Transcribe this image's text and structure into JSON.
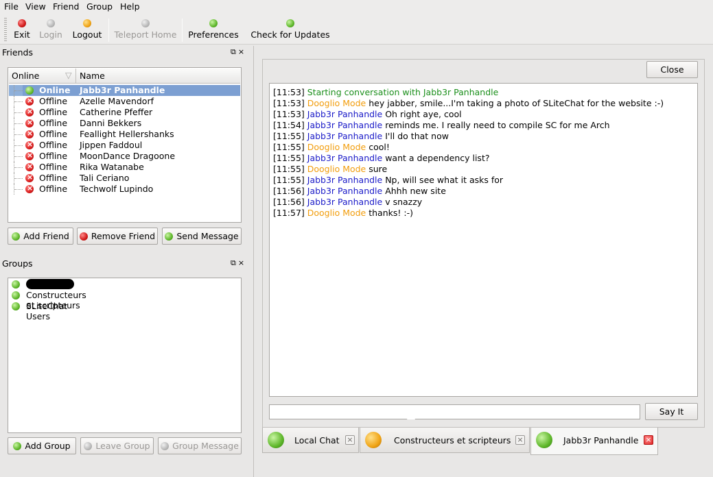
{
  "menu": {
    "items": [
      {
        "label": "File"
      },
      {
        "label": "View"
      },
      {
        "label": "Friend"
      },
      {
        "label": "Group"
      },
      {
        "label": "Help"
      }
    ]
  },
  "toolbar": {
    "exit": "Exit",
    "login": "Login",
    "logout": "Logout",
    "teleport_home": "Teleport Home",
    "preferences": "Preferences",
    "check_updates": "Check for Updates"
  },
  "friends_panel": {
    "title": "Friends",
    "col_online": "Online",
    "col_name": "Name",
    "friends": [
      {
        "status": "Online",
        "name": "Jabb3r Panhandle"
      },
      {
        "status": "Offline",
        "name": "Azelle Mavendorf"
      },
      {
        "status": "Offline",
        "name": "Catherine Pfeffer"
      },
      {
        "status": "Offline",
        "name": "Danni Bekkers"
      },
      {
        "status": "Offline",
        "name": "Feallight Hellershanks"
      },
      {
        "status": "Offline",
        "name": "Jippen Faddoul"
      },
      {
        "status": "Offline",
        "name": "MoonDance Dragoone"
      },
      {
        "status": "Offline",
        "name": "Rika Watanabe"
      },
      {
        "status": "Offline",
        "name": "Tali Ceriano"
      },
      {
        "status": "Offline",
        "name": "Techwolf Lupindo"
      }
    ],
    "add_friend": "Add Friend",
    "remove_friend": "Remove Friend",
    "send_message": "Send Message"
  },
  "groups_panel": {
    "title": "Groups",
    "groups": [
      {
        "name": "Constructeurs et scripteurs"
      },
      {
        "name": "SLiteChat Users"
      }
    ],
    "add_group": "Add Group",
    "leave_group": "Leave Group",
    "group_message": "Group Message"
  },
  "chat": {
    "close_label": "Close",
    "say_label": "Say It",
    "input_value": "",
    "messages": [
      {
        "time": "[11:53]",
        "who": "",
        "text": "Starting conversation with Jabb3r Panhandle",
        "kind": "sys"
      },
      {
        "time": "[11:53]",
        "who": "Dooglio Mode",
        "text": "hey jabber, smile...I'm taking a photo of SLiteChat for the website :-)",
        "kind": "d"
      },
      {
        "time": "[11:53]",
        "who": "Jabb3r Panhandle",
        "text": "Oh right aye, cool",
        "kind": "j"
      },
      {
        "time": "[11:54]",
        "who": "Jabb3r Panhandle",
        "text": "reminds me. I really need to compile SC for me Arch",
        "kind": "j"
      },
      {
        "time": "[11:55]",
        "who": "Jabb3r Panhandle",
        "text": "I'll do that now",
        "kind": "j"
      },
      {
        "time": "[11:55]",
        "who": "Dooglio Mode",
        "text": "cool!",
        "kind": "d"
      },
      {
        "time": "[11:55]",
        "who": "Jabb3r Panhandle",
        "text": "want a dependency list?",
        "kind": "j"
      },
      {
        "time": "[11:55]",
        "who": "Dooglio Mode",
        "text": "sure",
        "kind": "d"
      },
      {
        "time": "[11:55]",
        "who": "Jabb3r Panhandle",
        "text": "Np, will see what it asks for",
        "kind": "j"
      },
      {
        "time": "[11:56]",
        "who": "Jabb3r Panhandle",
        "text": "Ahhh new site",
        "kind": "j"
      },
      {
        "time": "[11:56]",
        "who": "Jabb3r Panhandle",
        "text": "v snazzy",
        "kind": "j"
      },
      {
        "time": "[11:57]",
        "who": "Dooglio Mode",
        "text": "thanks! :-)",
        "kind": "d"
      }
    ],
    "tabs": [
      {
        "label": "Local Chat"
      },
      {
        "label": "Constructeurs et scripteurs"
      },
      {
        "label": "Jabb3r Panhandle"
      }
    ]
  }
}
